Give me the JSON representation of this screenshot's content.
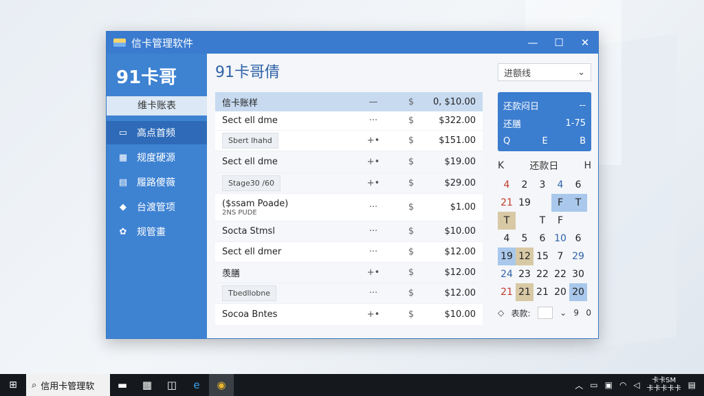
{
  "window": {
    "title": "信卡管理软件",
    "controls": {
      "minimize": "—",
      "maximize": "☐",
      "close": "✕"
    }
  },
  "sidebar": {
    "brand": "91卡哥",
    "top_button": "维卡账表",
    "items": [
      {
        "icon": "▭",
        "label": "高点首频"
      },
      {
        "icon": "▦",
        "label": "规度硬源"
      },
      {
        "icon": "▤",
        "label": "履路傻薇"
      },
      {
        "icon": "◆",
        "label": "台渡管项"
      },
      {
        "icon": "✿",
        "label": "规管畫"
      }
    ]
  },
  "main": {
    "title": "91卡哥倩",
    "table_header": {
      "name": "信卡账样",
      "c2": "—",
      "c3": "$",
      "amount": "0, $10.00"
    },
    "rows": [
      {
        "name": "Sect ell dme",
        "c2": "···",
        "c3": "$",
        "amount": "$322.00",
        "chip": "",
        "sub": ""
      },
      {
        "name": "",
        "c2": "+•",
        "c3": "$",
        "amount": "$151.00",
        "chip": "Sbert lhahd",
        "sub": ""
      },
      {
        "name": "Sect ell dme",
        "c2": "+•",
        "c3": "$",
        "amount": "$19.00",
        "chip": "",
        "sub": ""
      },
      {
        "name": "",
        "c2": "+•",
        "c3": "$",
        "amount": "$29.00",
        "chip": "Stage30 /60",
        "sub": ""
      },
      {
        "name": "($ssam Poade)",
        "c2": "···",
        "c3": "$",
        "amount": "$1.00",
        "chip": "",
        "sub": "2NS PUDE"
      },
      {
        "name": "Socta Stmsl",
        "c2": "···",
        "c3": "$",
        "amount": "$10.00",
        "chip": "",
        "sub": ""
      },
      {
        "name": "Sect ell dmer",
        "c2": "···",
        "c3": "$",
        "amount": "$12.00",
        "chip": "",
        "sub": ""
      },
      {
        "name": "羡膳",
        "c2": "+•",
        "c3": "$",
        "amount": "$12.00",
        "chip": "",
        "sub": ""
      },
      {
        "name": "",
        "c2": "···",
        "c3": "$",
        "amount": "$12.00",
        "chip": "Tbedllobne",
        "sub": ""
      },
      {
        "name": "Socoa Bntes",
        "c2": "+•",
        "c3": "$",
        "amount": "$10.00",
        "chip": "",
        "sub": ""
      }
    ]
  },
  "right": {
    "select_value": "进额线",
    "card": {
      "title": "还款闷日",
      "title_right": "--",
      "label": "还膳",
      "value": "1-75",
      "icons": [
        "Q",
        "E",
        "B"
      ]
    },
    "calendar": {
      "prev": "K",
      "title": "还款日",
      "next": "H",
      "days": [
        {
          "d": "4",
          "c": "red"
        },
        {
          "d": "2",
          "c": ""
        },
        {
          "d": "3",
          "c": ""
        },
        {
          "d": "4",
          "c": "blue"
        },
        {
          "d": "6",
          "c": ""
        },
        {
          "d": "21",
          "c": "red"
        },
        {
          "d": "19",
          "c": ""
        },
        {
          "d": "",
          "c": ""
        },
        {
          "d": "F",
          "c": "hl"
        },
        {
          "d": "T",
          "c": "hl"
        },
        {
          "d": "T",
          "c": "hl2"
        },
        {
          "d": "",
          "c": ""
        },
        {
          "d": "T",
          "c": ""
        },
        {
          "d": "F",
          "c": ""
        },
        {
          "d": "",
          "c": ""
        },
        {
          "d": "4",
          "c": ""
        },
        {
          "d": "5",
          "c": ""
        },
        {
          "d": "6",
          "c": ""
        },
        {
          "d": "10",
          "c": "blue"
        },
        {
          "d": "6",
          "c": ""
        },
        {
          "d": "19",
          "c": "hl"
        },
        {
          "d": "12",
          "c": "hl2"
        },
        {
          "d": "15",
          "c": ""
        },
        {
          "d": "7",
          "c": ""
        },
        {
          "d": "29",
          "c": "blue"
        },
        {
          "d": "24",
          "c": "blue"
        },
        {
          "d": "23",
          "c": ""
        },
        {
          "d": "22",
          "c": ""
        },
        {
          "d": "22",
          "c": ""
        },
        {
          "d": "30",
          "c": ""
        },
        {
          "d": "21",
          "c": "red"
        },
        {
          "d": "21",
          "c": "hl2"
        },
        {
          "d": "21",
          "c": ""
        },
        {
          "d": "20",
          "c": ""
        },
        {
          "d": "20",
          "c": "hl"
        }
      ],
      "footer_label": "表款:",
      "footer_v1": "9",
      "footer_v2": "0"
    }
  },
  "taskbar": {
    "search_text": "信用卡管理软",
    "tray_time": "卡卡SM",
    "tray_date": "卡卡卡卡卡"
  }
}
